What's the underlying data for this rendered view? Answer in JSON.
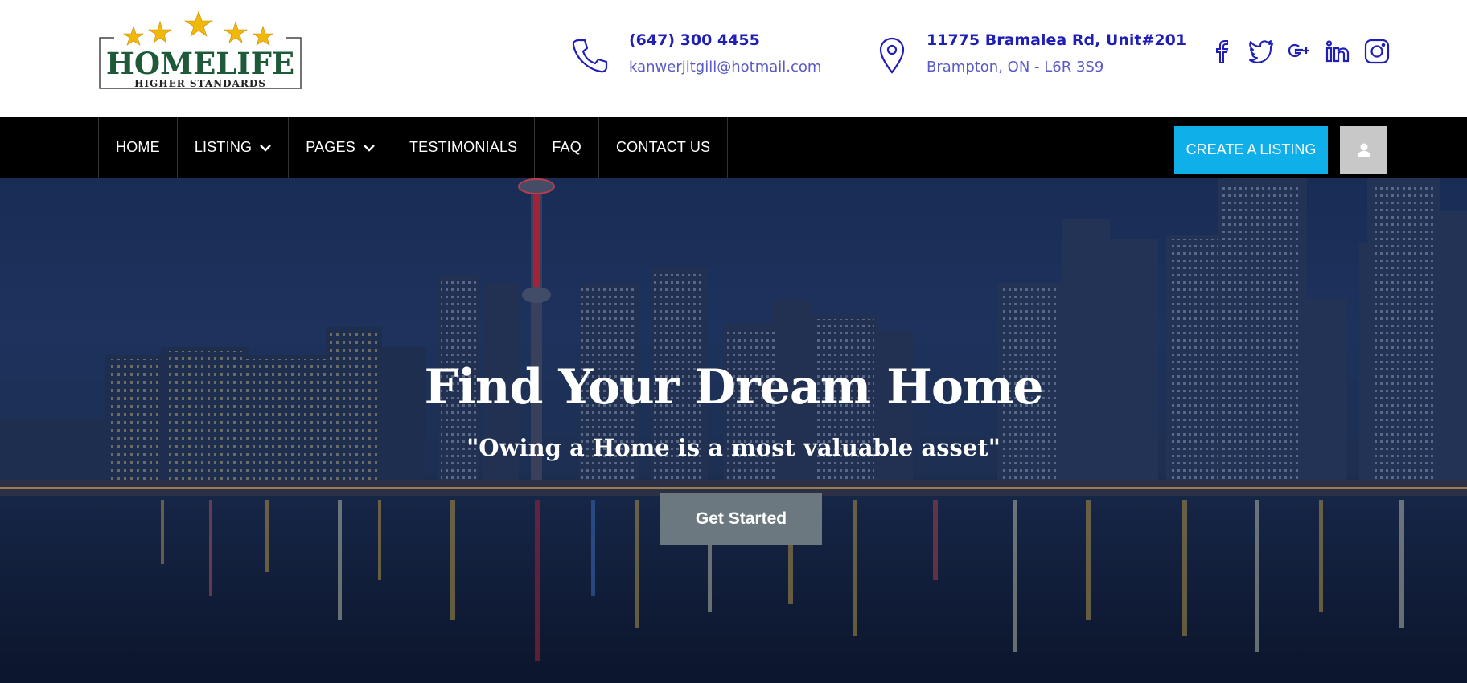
{
  "brand": {
    "logo_name": "HOMELIFE",
    "logo_tagline": "HIGHER STANDARDS"
  },
  "contact": {
    "phone": "(647) 300 4455",
    "email": "kanwerjitgill@hotmail.com",
    "address_line1": "11775 Bramalea Rd, Unit#201",
    "address_line2": "Brampton, ON - L6R 3S9"
  },
  "social": [
    "facebook-icon",
    "twitter-icon",
    "google-plus-icon",
    "linkedin-icon",
    "instagram-icon"
  ],
  "nav": {
    "items": [
      {
        "label": "HOME"
      },
      {
        "label": "LISTING",
        "dropdown": true
      },
      {
        "label": "PAGES",
        "dropdown": true
      },
      {
        "label": "TESTIMONIALS"
      },
      {
        "label": "FAQ"
      },
      {
        "label": "CONTACT US"
      }
    ],
    "create_label": "CREATE A LISTING"
  },
  "hero": {
    "title": "Find Your Dream Home",
    "subtitle": "\"Owing a Home is a most valuable asset\"",
    "cta_label": "Get Started"
  },
  "colors": {
    "accent": "#1f1fb8",
    "create_button": "#0fb0ea",
    "nav_bg": "#000000",
    "logo_green": "#1e5a3a",
    "star_gold": "#f2b807"
  }
}
